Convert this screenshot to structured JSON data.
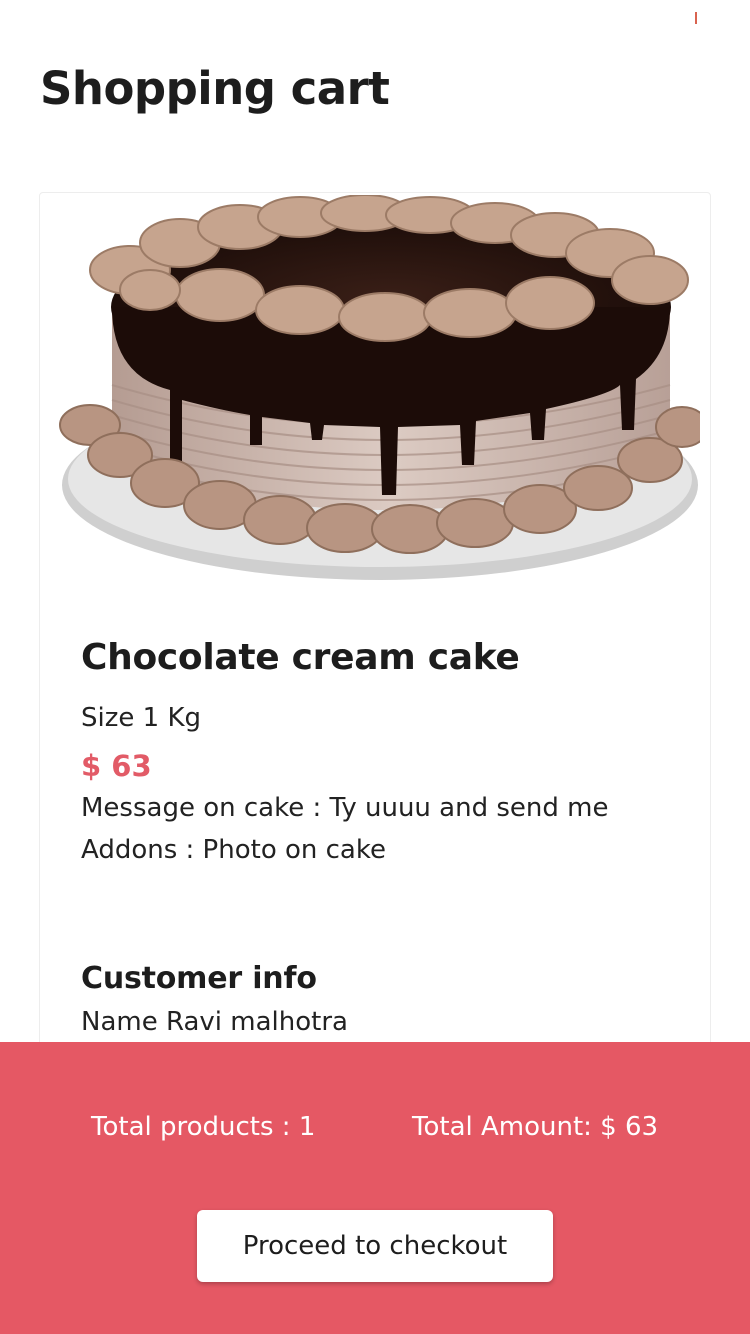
{
  "header": {
    "title": "Shopping cart"
  },
  "cart": {
    "items": [
      {
        "name": "Chocolate cream cake",
        "size": "Size 1 Kg",
        "price": "$ 63",
        "message": "Message on cake : Ty uuuu and send me",
        "addons": "Addons : Photo on cake",
        "image_icon": "chocolate-cake-image"
      }
    ],
    "customer": {
      "title": "Customer info",
      "name": "Name Ravi malhotra"
    }
  },
  "footer": {
    "total_products": "Total products : 1",
    "total_amount": "Total Amount: $ 63",
    "checkout_label": "Proceed to checkout"
  },
  "colors": {
    "accent": "#e55864",
    "price": "#e25b67",
    "text": "#1d1d1d",
    "background": "#ffffff"
  }
}
